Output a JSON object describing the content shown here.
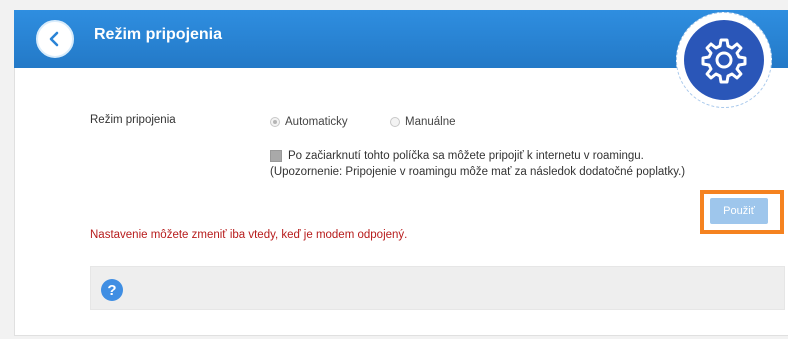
{
  "header": {
    "title": "Režim pripojenia",
    "back_icon": "chevron-left-icon",
    "gear_icon": "gear-icon",
    "color": "#2a84d6"
  },
  "connection_mode": {
    "label": "Režim pripojenia",
    "options": [
      {
        "label": "Automaticky",
        "selected": true
      },
      {
        "label": "Manuálne",
        "selected": false
      }
    ]
  },
  "roaming": {
    "checkbox_label": "Po začiarknutí tohto políčka sa môžete pripojiť k internetu v roamingu.",
    "note": "(Upozornenie: Pripojenie v roamingu môže mať za následok dodatočné poplatky.)",
    "checked": false
  },
  "apply": {
    "label": "Použiť",
    "highlight_color": "#f58220"
  },
  "warning": {
    "text": "Nastavenie môžete zmeniť iba vtedy, keď je modem odpojený.",
    "color": "#b71c1c"
  },
  "help": {
    "icon": "help-icon",
    "glyph": "?"
  }
}
